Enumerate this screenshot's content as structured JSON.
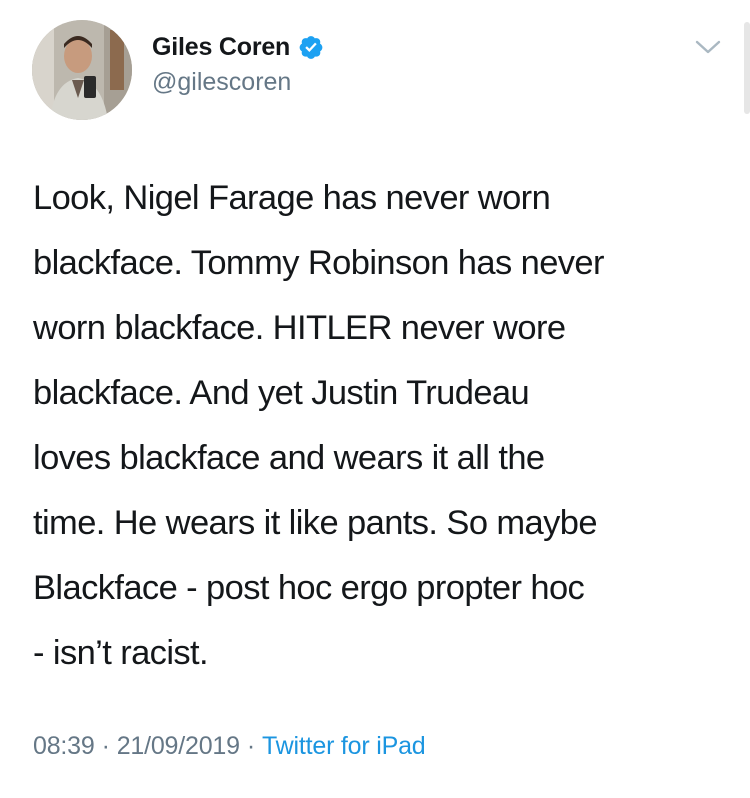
{
  "author": {
    "display_name": "Giles Coren",
    "handle": "@gilescoren",
    "verified": true,
    "avatar_icon": "profile-photo"
  },
  "tweet": {
    "text": "Look, Nigel Farage has never worn\nblackface. Tommy Robinson has never\nworn blackface. HITLER never wore\nblackface. And yet Justin Trudeau\nloves blackface and wears it all the\ntime. He wears it like pants. So maybe\nBlackface - post hoc ergo propter hoc\n- isn’t racist."
  },
  "meta": {
    "time": "08:39",
    "separator": "·",
    "date": "21/09/2019",
    "source": "Twitter for iPad"
  },
  "icons": {
    "verified": "verified-badge-icon",
    "more": "chevron-down-icon"
  },
  "colors": {
    "text": "#14171a",
    "secondary": "#657786",
    "link": "#1b95e0",
    "verified": "#1da1f2"
  }
}
